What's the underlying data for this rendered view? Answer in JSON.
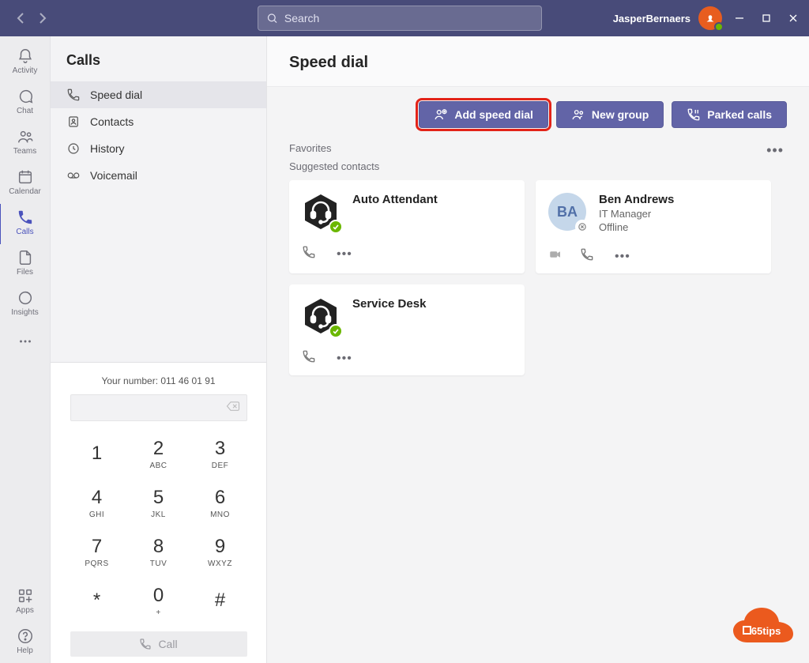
{
  "titlebar": {
    "search_placeholder": "Search",
    "username": "JasperBernaers"
  },
  "rail": {
    "items": [
      {
        "id": "activity",
        "label": "Activity"
      },
      {
        "id": "chat",
        "label": "Chat"
      },
      {
        "id": "teams",
        "label": "Teams"
      },
      {
        "id": "calendar",
        "label": "Calendar"
      },
      {
        "id": "calls",
        "label": "Calls"
      },
      {
        "id": "files",
        "label": "Files"
      },
      {
        "id": "insights",
        "label": "Insights"
      }
    ],
    "apps_label": "Apps",
    "help_label": "Help"
  },
  "sidebar": {
    "title": "Calls",
    "items": [
      {
        "id": "speed-dial",
        "label": "Speed dial"
      },
      {
        "id": "contacts",
        "label": "Contacts"
      },
      {
        "id": "history",
        "label": "History"
      },
      {
        "id": "voicemail",
        "label": "Voicemail"
      }
    ]
  },
  "dialer": {
    "number_text": "Your number: 011 46 01 91",
    "keys": [
      {
        "d": "1",
        "l": ""
      },
      {
        "d": "2",
        "l": "ABC"
      },
      {
        "d": "3",
        "l": "DEF"
      },
      {
        "d": "4",
        "l": "GHI"
      },
      {
        "d": "5",
        "l": "JKL"
      },
      {
        "d": "6",
        "l": "MNO"
      },
      {
        "d": "7",
        "l": "PQRS"
      },
      {
        "d": "8",
        "l": "TUV"
      },
      {
        "d": "9",
        "l": "WXYZ"
      },
      {
        "d": "*",
        "l": ""
      },
      {
        "d": "0",
        "l": "+"
      },
      {
        "d": "#",
        "l": ""
      }
    ],
    "call_label": "Call"
  },
  "main": {
    "title": "Speed dial",
    "actions": {
      "add_speed_dial": "Add speed dial",
      "new_group": "New group",
      "parked_calls": "Parked calls"
    },
    "favorites_label": "Favorites",
    "suggested_label": "Suggested contacts",
    "contacts": [
      {
        "name": "Auto Attendant",
        "subtitle": "",
        "status": "",
        "type": "bot",
        "presence": "available",
        "initials": ""
      },
      {
        "name": "Ben Andrews",
        "subtitle": "IT Manager",
        "status": "Offline",
        "type": "person",
        "presence": "offline",
        "initials": "BA"
      },
      {
        "name": "Service Desk",
        "subtitle": "",
        "status": "",
        "type": "bot",
        "presence": "available",
        "initials": ""
      }
    ]
  },
  "watermark": {
    "text": "365tips"
  }
}
